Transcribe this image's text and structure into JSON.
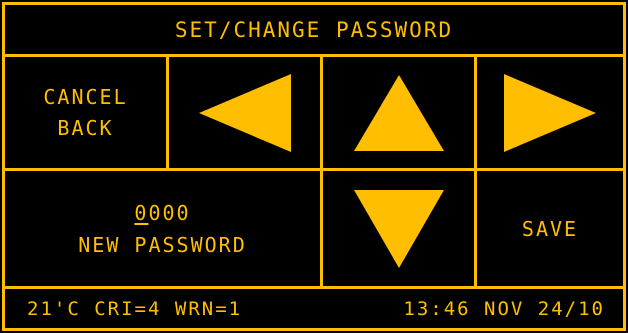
{
  "title": "SET/CHANGE PASSWORD",
  "cancel": {
    "line1": "CANCEL",
    "line2": "BACK"
  },
  "arrows": {
    "left_icon": "left-arrow-icon",
    "up_icon": "up-arrow-icon",
    "right_icon": "right-arrow-icon",
    "down_icon": "down-arrow-icon"
  },
  "password": {
    "cursor_digit": "0",
    "remaining_digits": "000",
    "label": "NEW PASSWORD"
  },
  "save_label": "SAVE",
  "status": {
    "temperature": "21'C",
    "cri": "CRI=4",
    "wrn": "WRN=1",
    "time": "13:46",
    "date": "NOV 24/10"
  },
  "colors": {
    "foreground": "#FFBE00",
    "background": "#000000"
  }
}
